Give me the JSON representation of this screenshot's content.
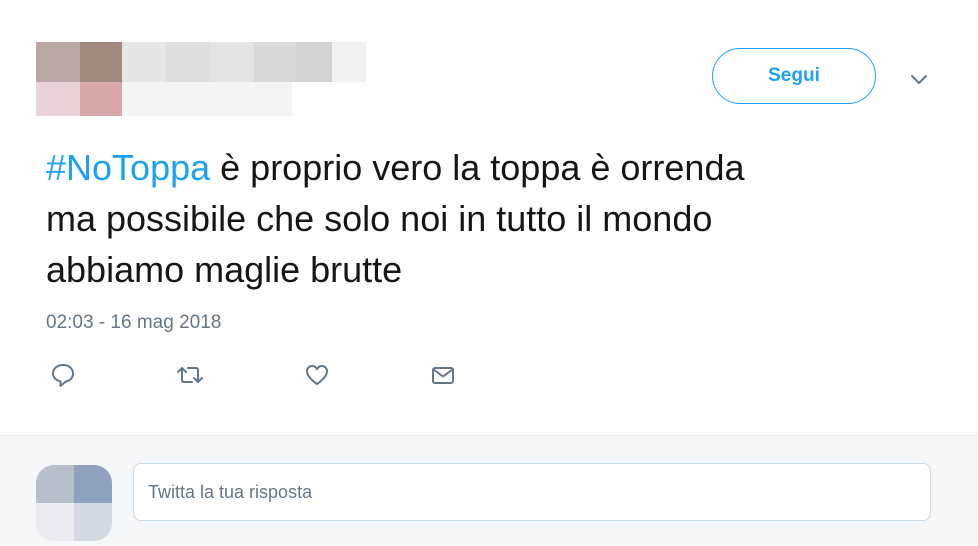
{
  "tweet": {
    "follow_label": "Segui",
    "hashtag": "#NoToppa",
    "text_line1": " è proprio vero la toppa è orrenda",
    "text_line2": "ma possibile che solo noi in tutto il mondo",
    "text_line3": "abbiamo maglie brutte",
    "timestamp": "02:03 - 16 mag 2018"
  },
  "icons": {
    "reply": "speech-bubble-icon",
    "retweet": "retweet-icon",
    "like": "heart-icon",
    "message": "envelope-icon",
    "more": "chevron-down-icon"
  },
  "reply_box": {
    "placeholder": "Twitta la tua risposta"
  },
  "colors": {
    "accent": "#1da1f2",
    "text": "#14171a",
    "muted": "#657786",
    "reply_bg": "#f5f8fa"
  }
}
